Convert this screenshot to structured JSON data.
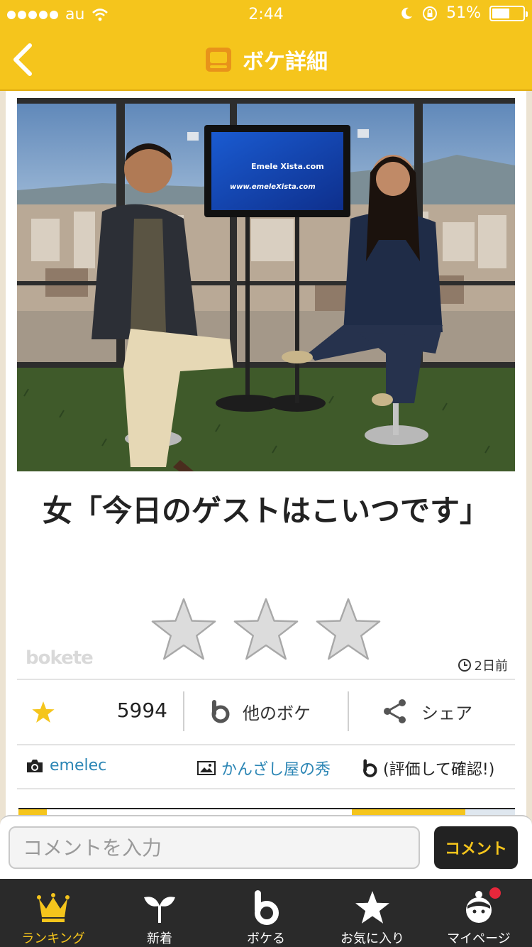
{
  "status_bar": {
    "carrier": "au",
    "time": "2:44",
    "battery": "51%"
  },
  "nav": {
    "title": "ボケ詳細"
  },
  "post": {
    "photo_texts": {
      "screen_logo": "Emele Xista.com",
      "screen_url": "www.emeleXista.com"
    },
    "caption": "女「今日のゲストはこいつです」",
    "rating_stars": 3,
    "watermark": "bokete",
    "posted_ago": "2日前",
    "star_count": "5994",
    "other_bokes_label": "他のボケ",
    "share_label": "シェア",
    "photo_user": "emelec",
    "boke_user": "かんざし屋の秀",
    "rate_to_confirm": "(評価して確認!)"
  },
  "comment": {
    "placeholder": "コメントを入力",
    "submit_label": "コメント"
  },
  "tabs": [
    {
      "label": "ランキング",
      "icon": "crown-icon",
      "active": true
    },
    {
      "label": "新着",
      "icon": "sprout-icon",
      "active": false
    },
    {
      "label": "ボケる",
      "icon": "bokete-b-icon",
      "active": false
    },
    {
      "label": "お気に入り",
      "icon": "star-icon",
      "active": false
    },
    {
      "label": "マイページ",
      "icon": "profile-icon",
      "active": false
    }
  ],
  "colors": {
    "brand_yellow": "#f5c51c",
    "tab_bar_bg": "#2a2a2a",
    "link_blue": "#2c86b5",
    "badge_red": "#e8273b"
  }
}
